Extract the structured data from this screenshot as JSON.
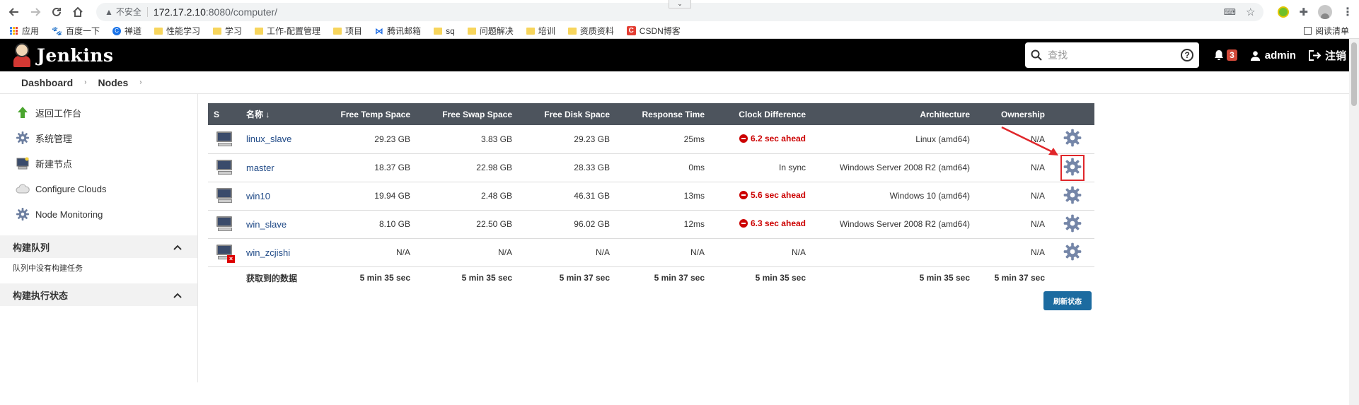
{
  "browser": {
    "insecure_label": "不安全",
    "url_host": "172.17.2.10",
    "url_path": ":8080/computer/",
    "bookmarks": [
      {
        "label": "应用",
        "icon": "apps-grid-icon"
      },
      {
        "label": "百度一下",
        "icon": "baidu-paw-icon"
      },
      {
        "label": "禅道",
        "icon": "zentao-icon"
      },
      {
        "label": "性能学习",
        "icon": "folder-icon"
      },
      {
        "label": "学习",
        "icon": "folder-icon"
      },
      {
        "label": "工作-配置管理",
        "icon": "folder-icon"
      },
      {
        "label": "项目",
        "icon": "folder-icon"
      },
      {
        "label": "腾讯邮箱",
        "icon": "tencent-mail-icon"
      },
      {
        "label": "sq",
        "icon": "folder-icon"
      },
      {
        "label": "问题解决",
        "icon": "folder-icon"
      },
      {
        "label": "培训",
        "icon": "folder-icon"
      },
      {
        "label": "资质资料",
        "icon": "folder-icon"
      },
      {
        "label": "CSDN博客",
        "icon": "csdn-icon"
      }
    ],
    "reading_list": "阅读清单"
  },
  "header": {
    "title": "Jenkins",
    "search_placeholder": "查找",
    "notification_count": "3",
    "user": "admin",
    "logout": "注销"
  },
  "breadcrumb": [
    "Dashboard",
    "Nodes"
  ],
  "sidebar": {
    "tasks": [
      {
        "label": "返回工作台",
        "icon": "up-arrow-icon"
      },
      {
        "label": "系统管理",
        "icon": "gear-icon"
      },
      {
        "label": "新建节点",
        "icon": "computer-icon"
      },
      {
        "label": "Configure Clouds",
        "icon": "cloud-icon"
      },
      {
        "label": "Node Monitoring",
        "icon": "gear-icon"
      }
    ],
    "queue": {
      "title": "构建队列",
      "empty": "队列中没有构建任务"
    },
    "executors": {
      "title": "构建执行状态"
    }
  },
  "table": {
    "headers": [
      "S",
      "名称 ↓",
      "Free Temp Space",
      "Free Swap Space",
      "Free Disk Space",
      "Response Time",
      "Clock Difference",
      "Architecture",
      "Ownership"
    ],
    "rows": [
      {
        "name": "linux_slave",
        "temp": "29.23 GB",
        "swap": "3.83 GB",
        "disk": "29.23 GB",
        "resp": "25ms",
        "clock": "6.2 sec ahead",
        "clock_warn": true,
        "arch": "Linux (amd64)",
        "owner": "N/A",
        "offline": false
      },
      {
        "name": "master",
        "temp": "18.37 GB",
        "swap": "22.98 GB",
        "disk": "28.33 GB",
        "resp": "0ms",
        "clock": "In sync",
        "clock_warn": false,
        "arch": "Windows Server 2008 R2 (amd64)",
        "owner": "N/A",
        "offline": false
      },
      {
        "name": "win10",
        "temp": "19.94 GB",
        "swap": "2.48 GB",
        "disk": "46.31 GB",
        "resp": "13ms",
        "clock": "5.6 sec ahead",
        "clock_warn": true,
        "arch": "Windows 10 (amd64)",
        "owner": "N/A",
        "offline": false
      },
      {
        "name": "win_slave",
        "temp": "8.10 GB",
        "swap": "22.50 GB",
        "disk": "96.02 GB",
        "resp": "12ms",
        "clock": "6.3 sec ahead",
        "clock_warn": true,
        "arch": "Windows Server 2008 R2 (amd64)",
        "owner": "N/A",
        "offline": false
      },
      {
        "name": "win_zcjishi",
        "temp": "N/A",
        "swap": "N/A",
        "disk": "N/A",
        "resp": "N/A",
        "clock": "N/A",
        "clock_warn": false,
        "arch": "",
        "owner": "N/A",
        "offline": true
      }
    ],
    "footer": {
      "label": "获取到的数据",
      "temp": "5 min 35 sec",
      "swap": "5 min 35 sec",
      "disk": "5 min 37 sec",
      "resp": "5 min 37 sec",
      "clock": "5 min 35 sec",
      "arch": "5 min 35 sec",
      "owner": "5 min 37 sec"
    }
  },
  "refresh_button": "刷新状态",
  "colors": {
    "header_bg": "#000000",
    "table_head": "#4d545d",
    "warn": "#cc0000",
    "link": "#204a87",
    "highlight": "#e0262a"
  }
}
